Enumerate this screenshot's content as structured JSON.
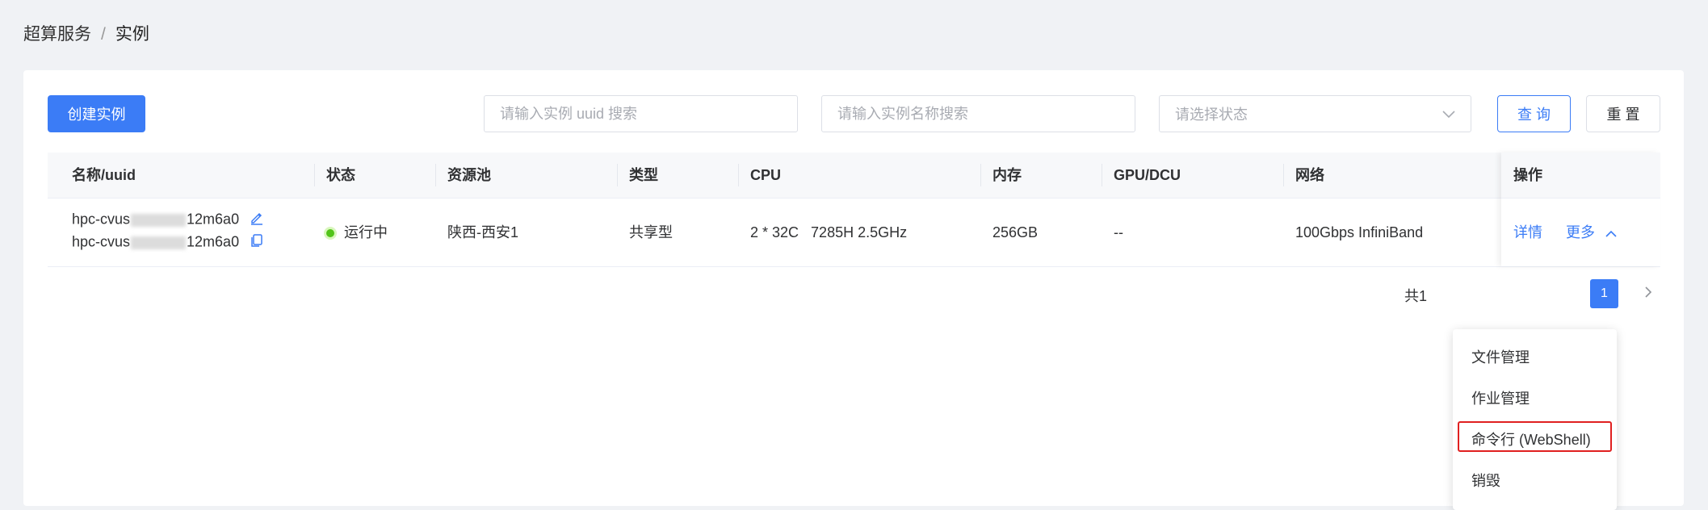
{
  "breadcrumb": {
    "parent": "超算服务",
    "separator": "/",
    "current": "实例"
  },
  "toolbar": {
    "create_label": "创建实例",
    "uuid_placeholder": "请输入实例 uuid 搜索",
    "name_placeholder": "请输入实例名称搜索",
    "status_placeholder": "请选择状态",
    "query_label": "查 询",
    "reset_label": "重 置"
  },
  "table": {
    "columns": [
      "名称/uuid",
      "状态",
      "资源池",
      "类型",
      "CPU",
      "内存",
      "GPU/DCU",
      "网络",
      "操作"
    ],
    "rows": [
      {
        "name_prefix": "hpc-cvus",
        "name_suffix": "12m6a0",
        "uuid_prefix": "hpc-cvus",
        "uuid_suffix": "12m6a0",
        "status": "运行中",
        "pool": "陕西-西安1",
        "type": "共享型",
        "cpu": "2 * 32C   7285H 2.5GHz",
        "memory": "256GB",
        "gpu": "--",
        "network": "100Gbps InfiniBand",
        "action_detail": "详情",
        "action_more": "更多"
      }
    ]
  },
  "pagination": {
    "total_text": "共1",
    "current_page": "1"
  },
  "dropdown": {
    "items": [
      "文件管理",
      "作业管理",
      "命令行 (WebShell)",
      "销毁"
    ],
    "highlighted_index": 2,
    "highlight_color": "#e02020"
  },
  "colors": {
    "primary": "#3b7cf6",
    "status_running": "#52c41a"
  }
}
